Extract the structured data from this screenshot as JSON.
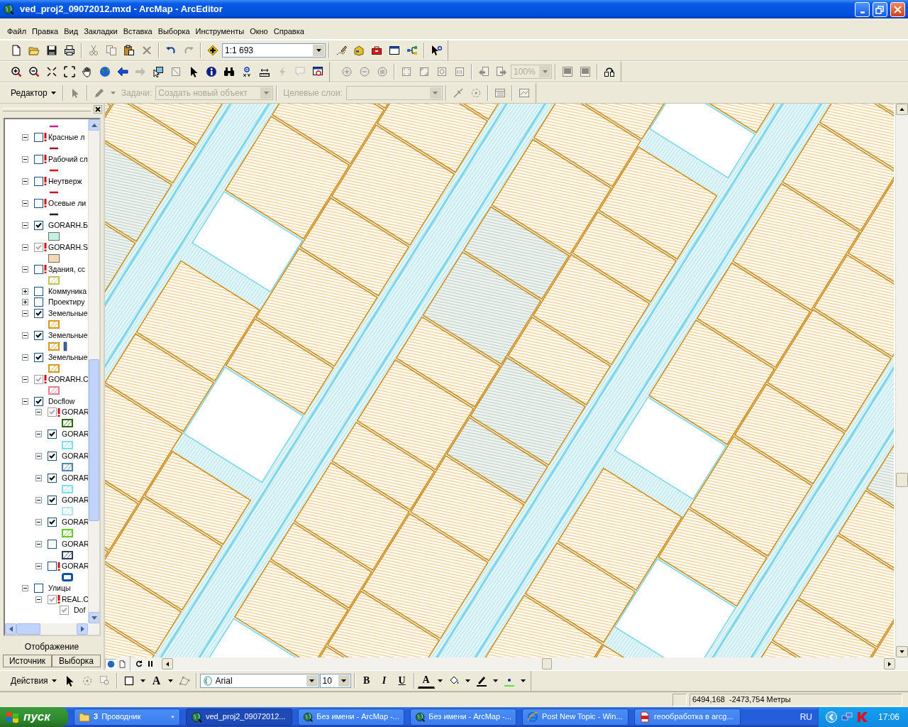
{
  "window": {
    "title": "ved_proj2_09072012.mxd - ArcMap - ArcEditor"
  },
  "menu": [
    {
      "label": "Файл"
    },
    {
      "label": "Правка"
    },
    {
      "label": "Вид"
    },
    {
      "label": "Закладки"
    },
    {
      "label": "Вставка"
    },
    {
      "label": "Выборка"
    },
    {
      "label": "Инструменты"
    },
    {
      "label": "Окно"
    },
    {
      "label": "Справка"
    }
  ],
  "standard_toolbar": [
    {
      "kind": "button",
      "disabled": false
    },
    {
      "kind": "button",
      "disabled": false
    },
    {
      "kind": "button",
      "disabled": false
    },
    {
      "kind": "button",
      "disabled": false
    },
    {
      "kind": "separator"
    },
    {
      "kind": "button",
      "disabled": true
    },
    {
      "kind": "button",
      "disabled": true
    },
    {
      "kind": "button",
      "disabled": false
    },
    {
      "kind": "button",
      "disabled": true
    },
    {
      "kind": "separator"
    },
    {
      "kind": "button",
      "disabled": false
    },
    {
      "kind": "button",
      "disabled": true
    },
    {
      "kind": "separator"
    },
    {
      "kind": "button",
      "disabled": false
    },
    {
      "kind": "combo",
      "value": "1:1 693",
      "disabled": false
    },
    {
      "kind": "separator"
    },
    {
      "kind": "button",
      "disabled": false
    },
    {
      "kind": "button",
      "disabled": false
    },
    {
      "kind": "button",
      "disabled": false
    },
    {
      "kind": "button",
      "disabled": false
    },
    {
      "kind": "button",
      "disabled": false
    },
    {
      "kind": "separator"
    },
    {
      "kind": "button",
      "disabled": false
    }
  ],
  "tools_toolbar": [
    {
      "kind": "button",
      "disabled": false
    },
    {
      "kind": "button",
      "disabled": false
    },
    {
      "kind": "button",
      "disabled": false
    },
    {
      "kind": "button",
      "disabled": false
    },
    {
      "kind": "button",
      "disabled": false
    },
    {
      "kind": "button",
      "disabled": false
    },
    {
      "kind": "button",
      "disabled": false
    },
    {
      "kind": "button",
      "disabled": true
    },
    {
      "kind": "button",
      "disabled": false
    },
    {
      "kind": "button",
      "disabled": true
    },
    {
      "kind": "button",
      "disabled": false
    },
    {
      "kind": "button",
      "disabled": false
    },
    {
      "kind": "button",
      "disabled": false
    },
    {
      "kind": "button",
      "disabled": false
    },
    {
      "kind": "button",
      "disabled": false
    },
    {
      "kind": "button",
      "disabled": true
    },
    {
      "kind": "button",
      "disabled": true
    },
    {
      "kind": "button",
      "disabled": false
    }
  ],
  "layout_toolbar": [
    {
      "kind": "button",
      "disabled": true
    },
    {
      "kind": "button",
      "disabled": true
    },
    {
      "kind": "button",
      "disabled": true
    },
    {
      "kind": "separator"
    },
    {
      "kind": "button",
      "disabled": true
    },
    {
      "kind": "button",
      "disabled": true
    },
    {
      "kind": "button",
      "disabled": true
    },
    {
      "kind": "button",
      "disabled": true
    },
    {
      "kind": "separator"
    },
    {
      "kind": "button",
      "disabled": true
    },
    {
      "kind": "button",
      "disabled": true
    },
    {
      "kind": "combo",
      "value": "100%",
      "disabled": true
    },
    {
      "kind": "separator"
    },
    {
      "kind": "button",
      "disabled": true
    },
    {
      "kind": "button",
      "disabled": true
    },
    {
      "kind": "separator"
    },
    {
      "kind": "button",
      "disabled": false
    }
  ],
  "editor_toolbar": [
    {
      "kind": "menu",
      "label": "Редактор",
      "disabled": false
    },
    {
      "kind": "separator"
    },
    {
      "kind": "button",
      "disabled": true
    },
    {
      "kind": "separator"
    },
    {
      "kind": "button",
      "disabled": true
    },
    {
      "kind": "caret",
      "disabled": true
    },
    {
      "kind": "label",
      "text": "Задачи:",
      "disabled": true
    },
    {
      "kind": "combo",
      "value": "Создать новый объект",
      "disabled": true
    },
    {
      "kind": "separator"
    },
    {
      "kind": "label",
      "text": "Целевые слои:",
      "disabled": true
    },
    {
      "kind": "combo",
      "disabled": true
    },
    {
      "kind": "separator"
    },
    {
      "kind": "button",
      "disabled": true
    },
    {
      "kind": "button",
      "disabled": true
    },
    {
      "kind": "separator"
    },
    {
      "kind": "button",
      "disabled": true
    },
    {
      "kind": "separator"
    },
    {
      "kind": "button",
      "disabled": true
    }
  ],
  "table_of_contents": {
    "top_symbol": {
      "kind": "line",
      "color": "#c81e9a"
    },
    "layers": [
      {
        "label": "Красные л",
        "expanded": true,
        "checked": false,
        "dimmed": false,
        "warning": true,
        "symbols": [
          {
            "kind": "line",
            "color": "#a01828"
          }
        ]
      },
      {
        "label": "Рабочий сл",
        "expanded": true,
        "checked": false,
        "dimmed": false,
        "warning": true,
        "symbols": [
          {
            "kind": "line",
            "color": "#e01010"
          }
        ]
      },
      {
        "label": "Неутверж",
        "expanded": true,
        "checked": false,
        "dimmed": false,
        "warning": true,
        "symbols": [
          {
            "kind": "line",
            "color": "#c01818"
          }
        ]
      },
      {
        "label": "Осевые ли",
        "expanded": true,
        "checked": false,
        "dimmed": false,
        "warning": true,
        "symbols": [
          {
            "kind": "line",
            "color": "#202020"
          }
        ]
      },
      {
        "label": "GORARH.Б",
        "expanded": true,
        "checked": true,
        "dimmed": false,
        "warning": false,
        "symbols": [
          {
            "kind": "fill",
            "color": "#c4f0e4"
          }
        ]
      },
      {
        "label": "GORARH.S",
        "expanded": true,
        "checked": true,
        "dimmed": true,
        "warning": true,
        "symbols": [
          {
            "kind": "fill",
            "color": "#f4d8b4"
          }
        ]
      },
      {
        "label": "Здания, сс",
        "expanded": true,
        "checked": false,
        "dimmed": false,
        "warning": true,
        "symbols": [
          {
            "kind": "hatch",
            "color": "#c8c060"
          }
        ]
      },
      {
        "label": "Коммуника",
        "expanded": false,
        "checked": false,
        "dimmed": false,
        "warning": false
      },
      {
        "label": "Проектиру",
        "expanded": false,
        "checked": false,
        "dimmed": false,
        "warning": false
      },
      {
        "label": "Земельные",
        "expanded": true,
        "checked": true,
        "dimmed": false,
        "warning": false,
        "symbols": [
          {
            "kind": "hatch",
            "color": "#d89a18"
          }
        ]
      },
      {
        "label": "Земельные",
        "expanded": true,
        "checked": true,
        "dimmed": false,
        "warning": false,
        "symbols": [
          {
            "kind": "hatch",
            "color": "#d89a18"
          },
          {
            "kind": "bar",
            "color": "#4060a0"
          }
        ]
      },
      {
        "label": "Земельные",
        "expanded": true,
        "checked": true,
        "dimmed": false,
        "warning": false,
        "symbols": [
          {
            "kind": "hatch",
            "color": "#d89a18"
          }
        ]
      },
      {
        "label": "GORARH.C",
        "expanded": true,
        "checked": true,
        "dimmed": true,
        "warning": true,
        "symbols": [
          {
            "kind": "hatch",
            "color": "#e88090"
          }
        ]
      },
      {
        "label": "Docflow",
        "expanded": true,
        "checked": true,
        "dimmed": false,
        "warning": false,
        "children": [
          {
            "label": "GORAR",
            "expanded": true,
            "checked": true,
            "dimmed": true,
            "warning": true,
            "symbols": [
              {
                "kind": "hatch",
                "color": "#2a6a10"
              }
            ]
          },
          {
            "label": "GORAR",
            "expanded": true,
            "checked": true,
            "dimmed": false,
            "warning": false,
            "symbols": [
              {
                "kind": "hatch",
                "color": "#80dcef"
              }
            ]
          },
          {
            "label": "GORAR",
            "expanded": true,
            "checked": true,
            "dimmed": false,
            "warning": false,
            "symbols": [
              {
                "kind": "hatch",
                "color": "#4f86b5"
              }
            ]
          },
          {
            "label": "GORAR",
            "expanded": true,
            "checked": true,
            "dimmed": false,
            "warning": false,
            "symbols": [
              {
                "kind": "hatch",
                "color": "#80dcef"
              }
            ]
          },
          {
            "label": "GORAR",
            "expanded": true,
            "checked": true,
            "dimmed": false,
            "warning": false,
            "symbols": [
              {
                "kind": "hatch",
                "color": "#b0e4f0"
              }
            ]
          },
          {
            "label": "GORAR",
            "expanded": true,
            "checked": true,
            "dimmed": false,
            "warning": false,
            "symbols": [
              {
                "kind": "hatch",
                "color": "#60d020"
              }
            ]
          },
          {
            "label": "GORAR",
            "expanded": true,
            "checked": false,
            "dimmed": false,
            "warning": false,
            "symbols": [
              {
                "kind": "hatch",
                "color": "#304060"
              }
            ]
          },
          {
            "label": "GORAR",
            "expanded": true,
            "checked": false,
            "dimmed": false,
            "warning": true,
            "symbols": [
              {
                "kind": "outline",
                "color": "#1050a0"
              }
            ]
          }
        ]
      },
      {
        "label": "Улицы",
        "expanded": true,
        "checked": false,
        "dimmed": false,
        "warning": false,
        "children": [
          {
            "label": "REAL.C",
            "expanded": true,
            "checked": true,
            "dimmed": true,
            "warning": true,
            "children": [
              {
                "label": "Dof",
                "checked": true,
                "dimmed": true,
                "warning": false
              }
            ]
          }
        ]
      }
    ],
    "tabs": [
      {
        "label": "Отображение",
        "selected": true
      },
      {
        "label": "Источник",
        "selected": false
      },
      {
        "label": "Выборка",
        "selected": false
      }
    ]
  },
  "map_view_buttons": [
    {
      "selected": true
    },
    {
      "selected": false
    }
  ],
  "drawing_toolbar": [
    {
      "kind": "menu",
      "label": "Действия",
      "disabled": false
    },
    {
      "kind": "button",
      "disabled": false
    },
    {
      "kind": "button",
      "disabled": true
    },
    {
      "kind": "button",
      "disabled": true
    },
    {
      "kind": "separator"
    },
    {
      "kind": "button",
      "disabled": false
    },
    {
      "kind": "caret",
      "disabled": false
    },
    {
      "kind": "text",
      "label": "A",
      "disabled": false
    },
    {
      "kind": "caret",
      "disabled": false
    },
    {
      "kind": "button",
      "disabled": true
    },
    {
      "kind": "separator"
    },
    {
      "kind": "combo",
      "value": "Arial",
      "disabled": false
    },
    {
      "kind": "combo",
      "value": "10",
      "disabled": false
    },
    {
      "kind": "separator"
    },
    {
      "kind": "text",
      "label": "B",
      "disabled": false
    },
    {
      "kind": "text",
      "label": "I",
      "disabled": false
    },
    {
      "kind": "text",
      "label": "U",
      "disabled": false
    },
    {
      "kind": "separator"
    },
    {
      "kind": "text",
      "label": "A",
      "disabled": false
    },
    {
      "kind": "caret",
      "disabled": false
    },
    {
      "kind": "button",
      "disabled": false
    },
    {
      "kind": "caret",
      "disabled": false
    },
    {
      "kind": "button",
      "disabled": false
    },
    {
      "kind": "caret",
      "disabled": false
    },
    {
      "kind": "button",
      "disabled": false
    },
    {
      "kind": "caret",
      "disabled": false
    }
  ],
  "status_bar": {
    "coordinates": "6494,168  -2473,754 Метры"
  },
  "taskbar": {
    "start": "пуск",
    "tasks": [
      {
        "kind": "group",
        "count": "3",
        "label": "Проводник",
        "selected": false
      },
      {
        "kind": "window",
        "label": "ved_proj2_09072012...",
        "selected": true
      },
      {
        "kind": "window",
        "label": "Без имени - ArcMap -...",
        "selected": false
      },
      {
        "kind": "window",
        "label": "Без имени - ArcMap -...",
        "selected": false
      },
      {
        "kind": "window",
        "label": "Post New Topic - Win...",
        "selected": false
      },
      {
        "kind": "window",
        "label": "геообработка в arcg...",
        "selected": false
      }
    ],
    "language": "RU",
    "clock": "17:06"
  }
}
